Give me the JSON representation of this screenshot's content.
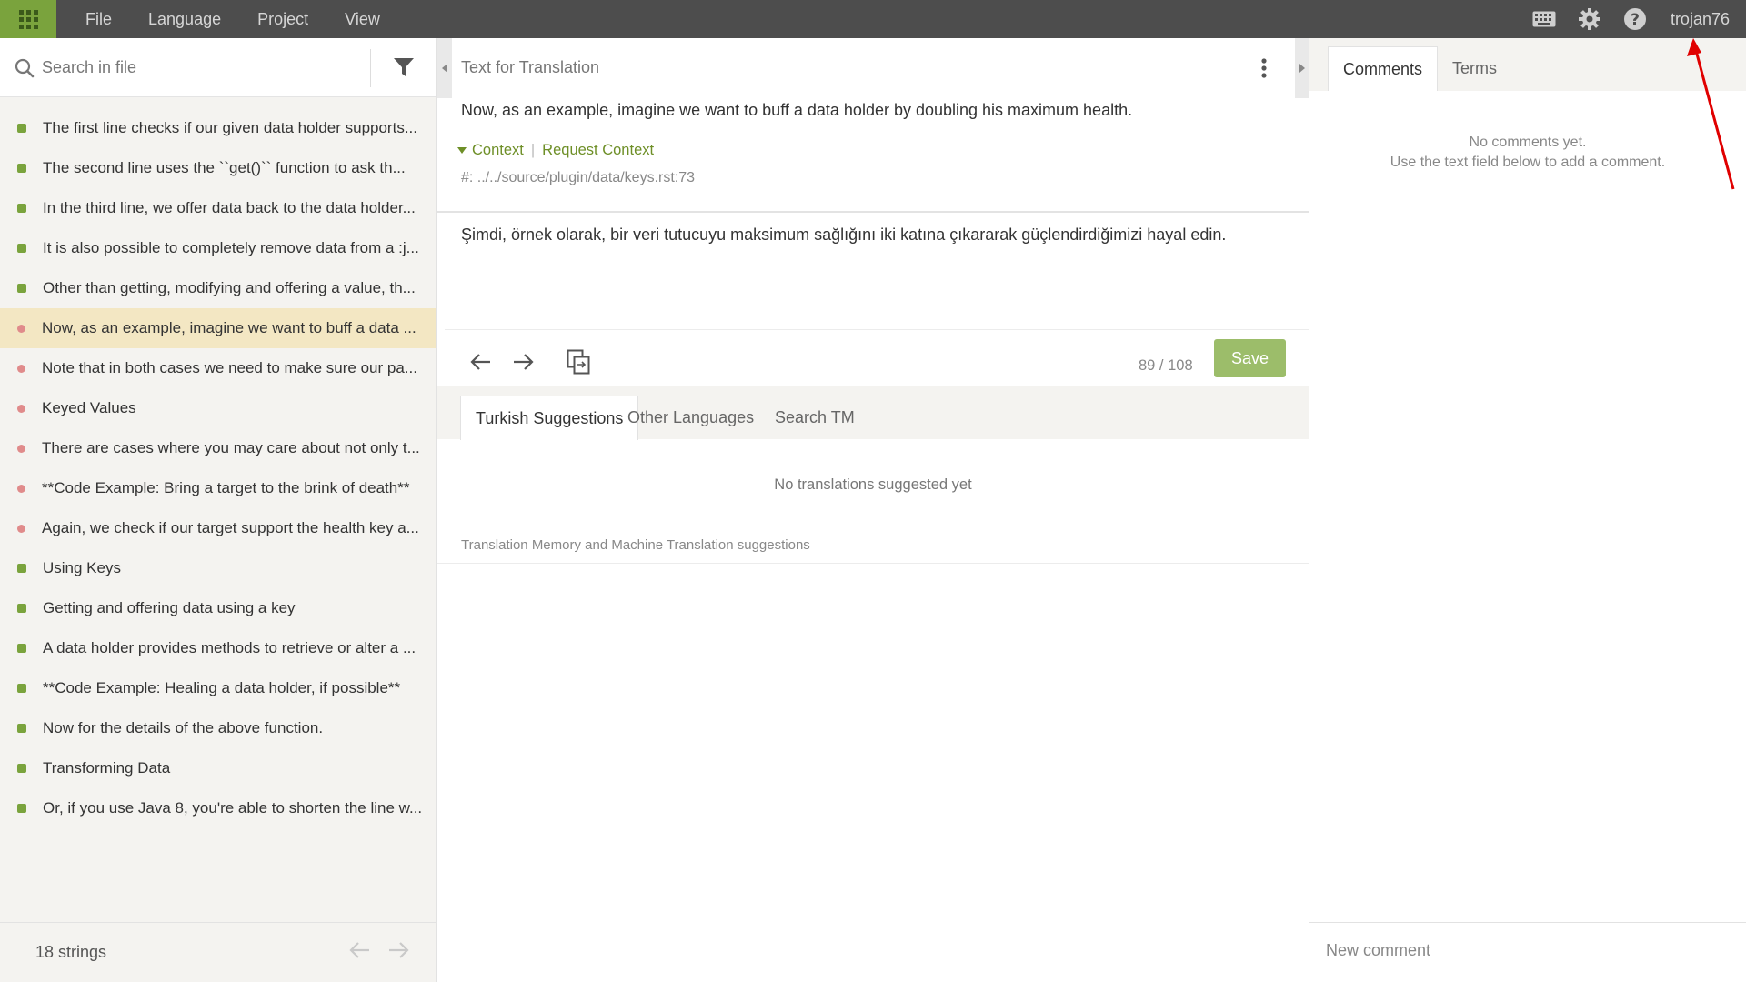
{
  "menu": {
    "items": [
      "File",
      "Language",
      "Project",
      "View"
    ]
  },
  "user": {
    "name": "trojan76"
  },
  "search": {
    "placeholder": "Search in file"
  },
  "strings": [
    {
      "text": "The first line checks if our given data holder supports...",
      "status": "translated"
    },
    {
      "text": "The second line uses the ``get()`` function to ask th...",
      "status": "translated"
    },
    {
      "text": "In the third line, we offer data back to the data holder...",
      "status": "translated"
    },
    {
      "text": "It is also possible to completely remove data from a :j...",
      "status": "translated"
    },
    {
      "text": "Other than getting, modifying and offering a value, th...",
      "status": "translated"
    },
    {
      "text": "Now, as an example, imagine we want to buff a data ...",
      "status": "untranslated",
      "active": true
    },
    {
      "text": "Note that in both cases we need to make sure our pa...",
      "status": "untranslated"
    },
    {
      "text": "Keyed Values",
      "status": "untranslated"
    },
    {
      "text": "There are cases where you may care about not only t...",
      "status": "untranslated"
    },
    {
      "text": "**Code Example: Bring a target to the brink of death**",
      "status": "untranslated"
    },
    {
      "text": "Again, we check if our target support the health key a...",
      "status": "untranslated"
    },
    {
      "text": "Using Keys",
      "status": "translated"
    },
    {
      "text": "Getting and offering data using a key",
      "status": "translated"
    },
    {
      "text": "A data holder provides methods to retrieve or alter a ...",
      "status": "translated"
    },
    {
      "text": "**Code Example: Healing a data holder, if possible**",
      "status": "translated"
    },
    {
      "text": "Now for the details of the above function.",
      "status": "translated"
    },
    {
      "text": "Transforming Data",
      "status": "translated"
    },
    {
      "text": "Or, if you use Java 8, you're able to shorten the line w...",
      "status": "translated"
    }
  ],
  "footer": {
    "count": "18 strings"
  },
  "editor": {
    "source_title": "Text for Translation",
    "source_text": "Now, as an example, imagine we want to buff a data holder by doubling his maximum health.",
    "context_label": "Context",
    "request_context_label": "Request Context",
    "location": "#: ../../source/plugin/data/keys.rst:73",
    "translation": "Şimdi, örnek olarak, bir veri tutucuyu maksimum sağlığını iki katına çıkararak güçlendirdiğimizi hayal edin.",
    "progress": "89 / 108",
    "save_label": "Save"
  },
  "suggestions": {
    "tabs": [
      "Turkish Suggestions",
      "Other Languages",
      "Search TM"
    ],
    "empty_text": "No translations suggested yet",
    "tm_label": "Translation Memory and Machine Translation suggestions"
  },
  "comments": {
    "tabs": [
      "Comments",
      "Terms"
    ],
    "empty_line1": "No comments yet.",
    "empty_line2": "Use the text field below to add a comment.",
    "placeholder": "New comment"
  },
  "colors": {
    "accent": "#7aa33d",
    "topbar": "#4d4d4d",
    "untranslated": "#e08b8b",
    "active_row": "#f3e7c3",
    "annotation": "#e00000"
  },
  "icons": [
    "apps-grid-icon",
    "keyboard-icon",
    "gear-icon",
    "help-icon",
    "search-icon",
    "filter-icon",
    "kebab-menu-icon",
    "arrow-left-icon",
    "arrow-right-icon",
    "copy-source-icon"
  ]
}
